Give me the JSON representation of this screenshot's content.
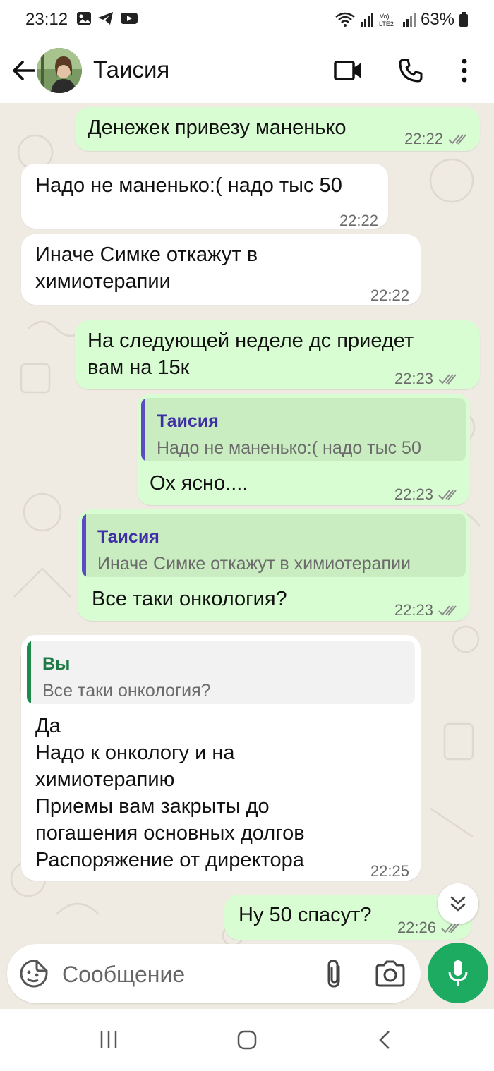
{
  "status_bar": {
    "time": "23:12",
    "battery": "63%"
  },
  "header": {
    "contact_name": "Таисия"
  },
  "messages": [
    {
      "type": "out",
      "text": "Денежек привезу маненько",
      "time": "22:22"
    },
    {
      "type": "in",
      "text": "Надо не маненько:( надо тыс 50",
      "time": "22:22"
    },
    {
      "type": "in",
      "text": "Иначе Симке откажут в\nхимиотерапии",
      "time": "22:22"
    },
    {
      "type": "out",
      "text": "На следующей неделе дс приедет\nвам на 15к",
      "time": "22:23"
    },
    {
      "type": "out",
      "quote_name": "Таисия",
      "quote_text": "Надо не маненько:( надо тыс 50",
      "text": "Ох ясно....",
      "time": "22:23"
    },
    {
      "type": "out",
      "quote_name": "Таисия",
      "quote_text": "Иначе Симке откажут в химиотерапии",
      "text": "Все таки онкология?",
      "time": "22:23"
    },
    {
      "type": "in",
      "quote_name": "Вы",
      "quote_text": "Все таки онкология?",
      "text": "Да\nНадо к онкологу и на\nхимиотерапию\nПриемы вам закрыты до\nпогашения основных долгов\nРаспоряжение от директора",
      "time": "22:25"
    },
    {
      "type": "out",
      "text": "Ну 50 спасут?",
      "time": "22:26"
    }
  ],
  "composer": {
    "placeholder": "Сообщение"
  },
  "colors": {
    "outgoing": "#d9fdd3",
    "incoming": "#ffffff",
    "accent": "#1daa61",
    "ticks": "#8c8c8c",
    "quote_contact": "#5b4bc4",
    "quote_self": "#1f8a4c"
  }
}
